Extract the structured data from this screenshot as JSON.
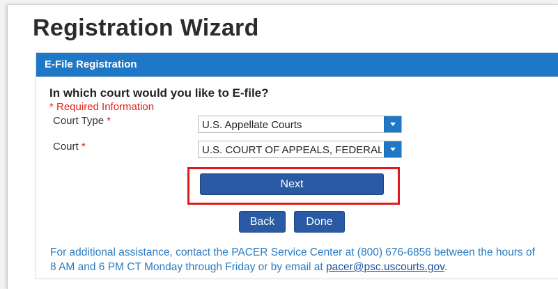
{
  "page": {
    "title": "Registration Wizard"
  },
  "panel": {
    "header": "E-File Registration",
    "question": "In which court would you like to E-file?",
    "required_note": "* Required Information"
  },
  "form": {
    "court_type": {
      "label": "Court Type",
      "required_mark": "*",
      "value": "U.S. Appellate Courts"
    },
    "court": {
      "label": "Court",
      "required_mark": "*",
      "value": "U.S. COURT OF APPEALS, FEDERAL CIRCUIT"
    }
  },
  "buttons": {
    "next": "Next",
    "back": "Back",
    "done": "Done"
  },
  "assistance": {
    "text": "For additional assistance, contact the PACER Service Center at (800) 676-6856 between the hours of 8 AM and 6 PM CT Monday through Friday or by email at ",
    "email": "pacer@psc.uscourts.gov",
    "trailing": "."
  },
  "colors": {
    "header": "#1f78c7",
    "button": "#2a5aa3",
    "required": "#e0241b",
    "highlight": "#e1191d"
  }
}
